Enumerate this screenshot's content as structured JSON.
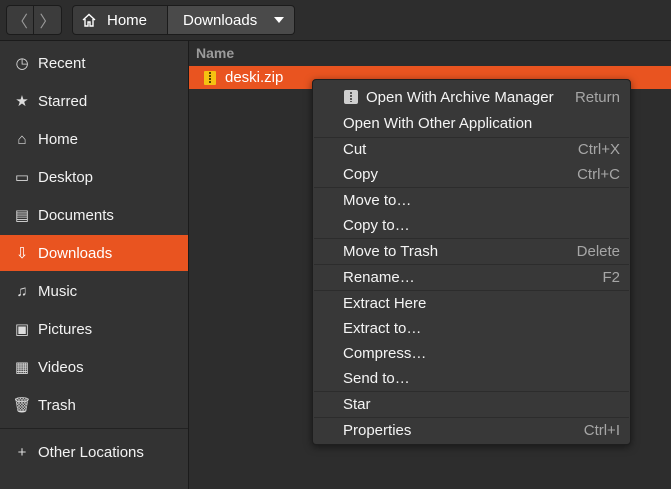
{
  "header": {
    "back_glyph": "〈",
    "forward_glyph": "〉",
    "breadcrumbs": [
      {
        "label": "Home",
        "icon": "home-icon"
      },
      {
        "label": "Downloads",
        "icon": "chevron-down-icon"
      }
    ]
  },
  "sidebar": {
    "items": [
      {
        "label": "Recent",
        "icon": "clock-icon",
        "glyph": "◷"
      },
      {
        "label": "Starred",
        "icon": "star-icon",
        "glyph": "★"
      },
      {
        "label": "Home",
        "icon": "home-icon",
        "glyph": "⌂"
      },
      {
        "label": "Desktop",
        "icon": "desktop-icon",
        "glyph": "▭"
      },
      {
        "label": "Documents",
        "icon": "document-icon",
        "glyph": "▤"
      },
      {
        "label": "Downloads",
        "icon": "download-icon",
        "glyph": "⇩",
        "active": true
      },
      {
        "label": "Music",
        "icon": "music-icon",
        "glyph": "♫"
      },
      {
        "label": "Pictures",
        "icon": "picture-icon",
        "glyph": "▣"
      },
      {
        "label": "Videos",
        "icon": "video-icon",
        "glyph": "▦"
      },
      {
        "label": "Trash",
        "icon": "trash-icon",
        "glyph": "🗑"
      }
    ],
    "other": {
      "label": "Other Locations",
      "icon": "plus-icon",
      "glyph": "+"
    }
  },
  "main": {
    "column_name": "Name",
    "files": [
      {
        "name": "deski.zip",
        "icon": "zip-file-icon",
        "selected": true
      }
    ]
  },
  "context_menu": {
    "items": [
      {
        "label": "Open With Archive Manager",
        "accel": "Return",
        "icon": "archive-manager-icon"
      },
      {
        "label": "Open With Other Application",
        "accel": ""
      },
      {
        "label": "Cut",
        "accel": "Ctrl+X"
      },
      {
        "label": "Copy",
        "accel": "Ctrl+C"
      },
      {
        "label": "Move to…",
        "accel": ""
      },
      {
        "label": "Copy to…",
        "accel": ""
      },
      {
        "label": "Move to Trash",
        "accel": "Delete"
      },
      {
        "label": "Rename…",
        "accel": "F2"
      },
      {
        "label": "Extract Here",
        "accel": ""
      },
      {
        "label": "Extract to…",
        "accel": ""
      },
      {
        "label": "Compress…",
        "accel": ""
      },
      {
        "label": "Send to…",
        "accel": ""
      },
      {
        "label": "Star",
        "accel": ""
      },
      {
        "label": "Properties",
        "accel": "Ctrl+I"
      }
    ]
  },
  "colors": {
    "accent": "#e95420",
    "sidebar_bg": "#333333",
    "window_bg": "#2d2d2d",
    "menu_bg": "#383838"
  }
}
